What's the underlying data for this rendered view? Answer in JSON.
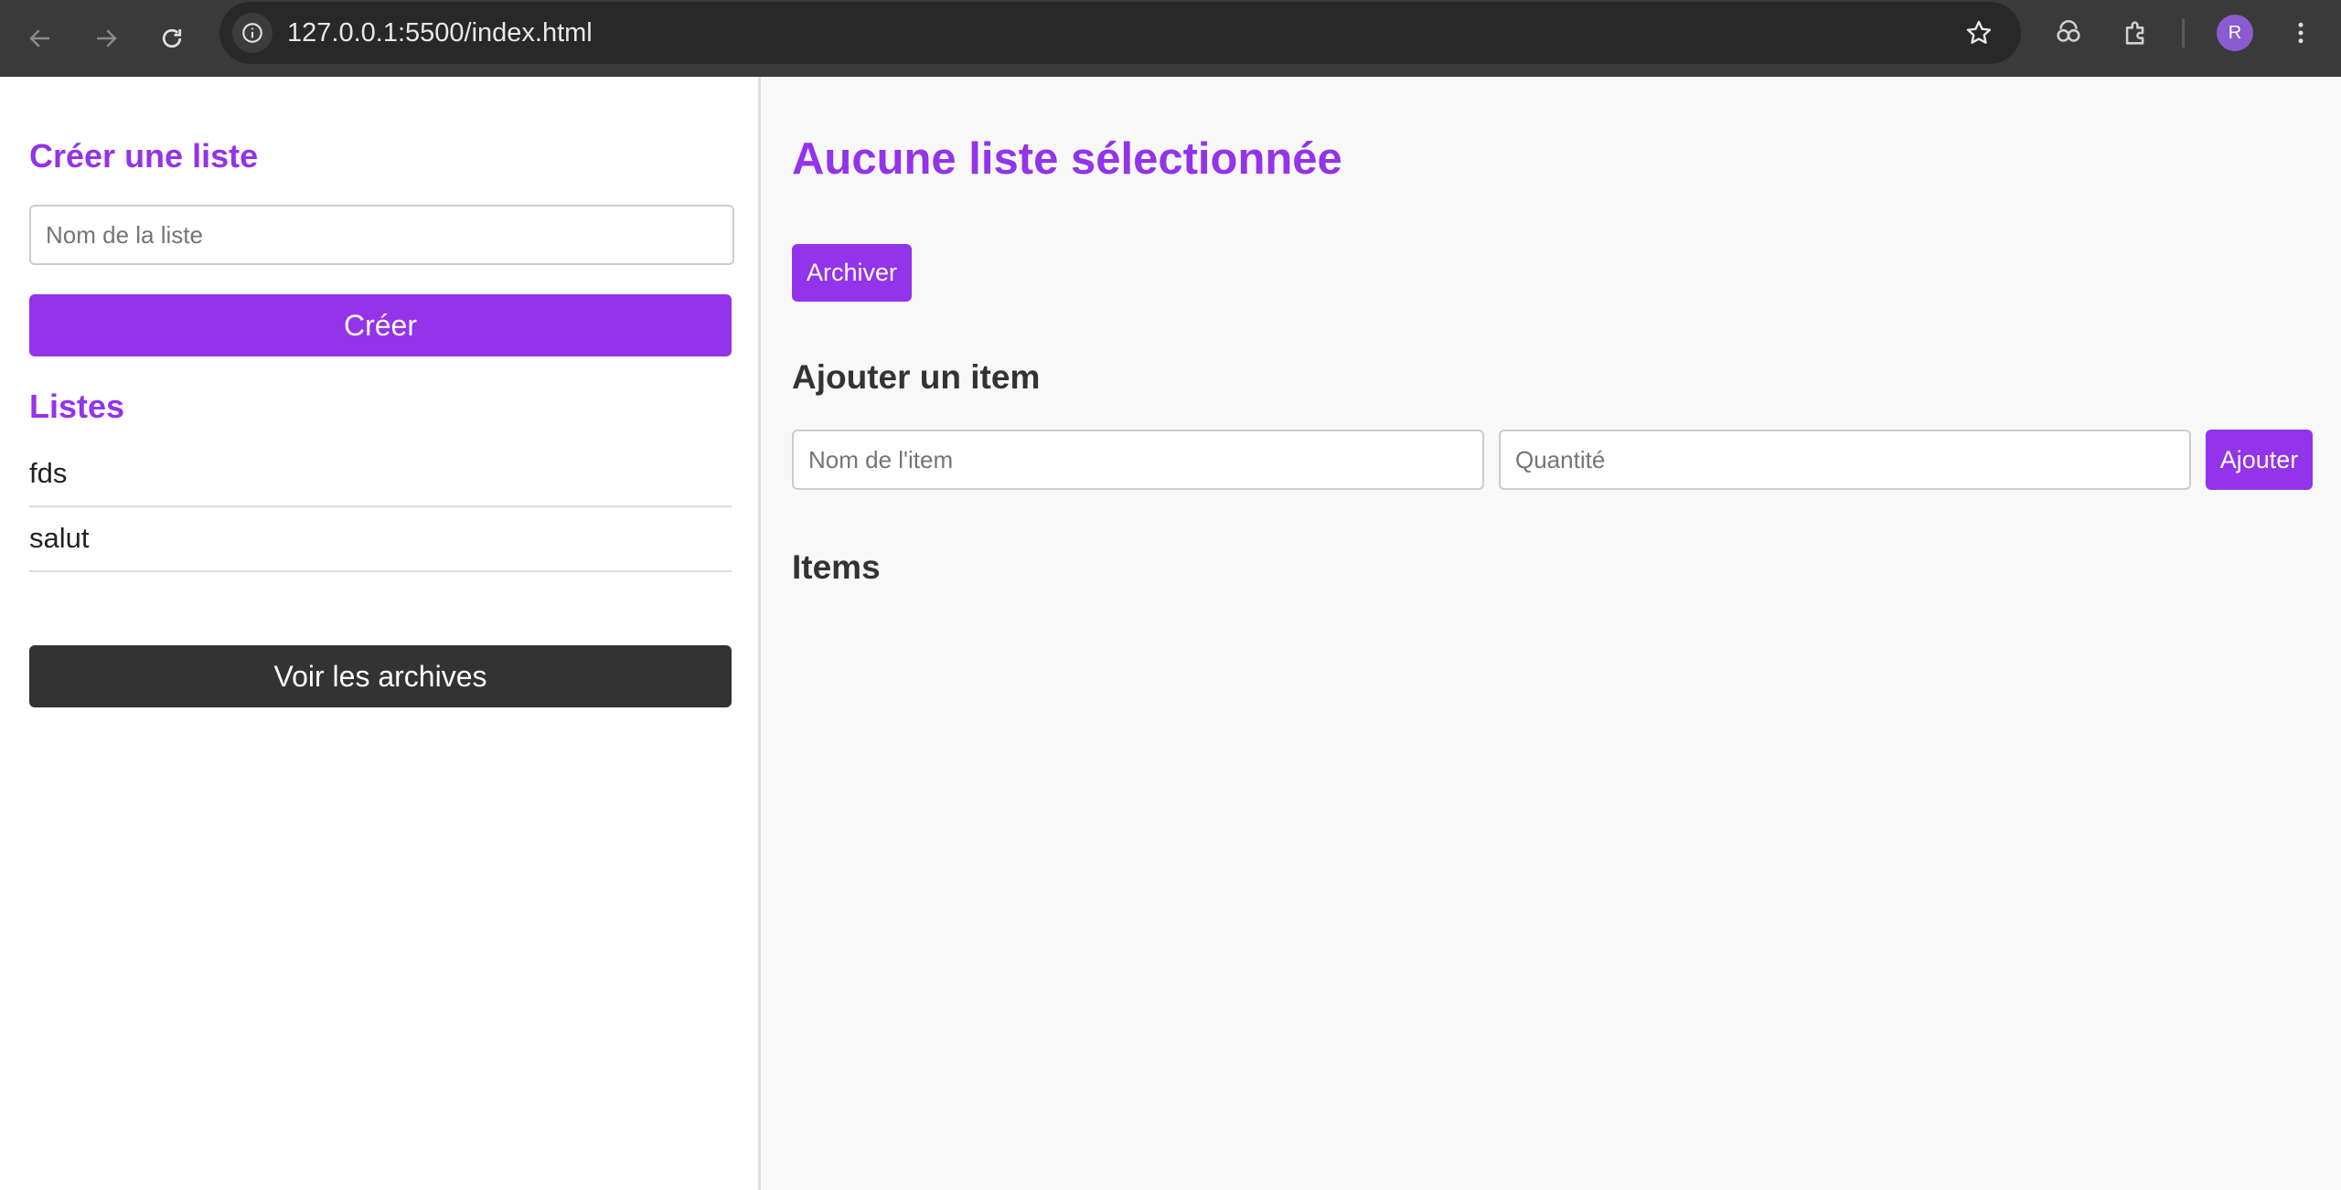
{
  "browser": {
    "url": "127.0.0.1:5500/index.html",
    "avatar_letter": "R",
    "icons": [
      "back-arrow-icon",
      "forward-arrow-icon",
      "reload-icon",
      "info-icon",
      "star-icon",
      "link-sync-icon",
      "extensions-icon",
      "menu-dots-icon"
    ]
  },
  "sidebar": {
    "create_title": "Créer une liste",
    "list_name_placeholder": "Nom de la liste",
    "create_button": "Créer",
    "lists_title": "Listes",
    "lists": [
      "fds",
      "salut"
    ],
    "archives_button": "Voir les archives"
  },
  "main": {
    "title": "Aucune liste sélectionnée",
    "archive_button": "Archiver",
    "add_item_title": "Ajouter un item",
    "item_name_placeholder": "Nom de l'item",
    "quantity_placeholder": "Quantité",
    "add_button": "Ajouter",
    "items_title": "Items"
  },
  "colors": {
    "accent": "#9333ea",
    "dark_button": "#333333",
    "chrome": "#3a3a3a"
  }
}
